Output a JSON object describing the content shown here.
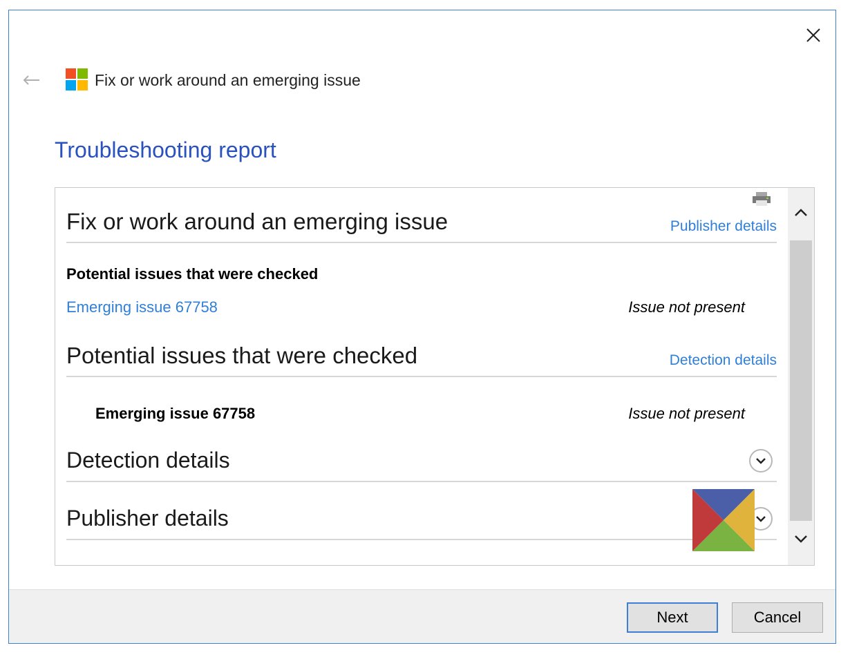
{
  "window": {
    "title": "Fix or work around an emerging issue",
    "icons": {
      "close": "close-icon",
      "back": "back-arrow-icon",
      "app": "windows-logo-icon"
    }
  },
  "heading": "Troubleshooting report",
  "report": {
    "section1": {
      "title": "Fix or work around an emerging issue",
      "link": "Publisher details",
      "subheading": "Potential issues that were checked",
      "issue_link": "Emerging issue 67758",
      "issue_status": "Issue not present"
    },
    "section2": {
      "title": "Potential issues that were checked",
      "link": "Detection details",
      "issue_label": "Emerging issue 67758",
      "issue_status": "Issue not present"
    },
    "section3": {
      "title": "Detection details"
    },
    "section4": {
      "title": "Publisher details"
    }
  },
  "buttons": {
    "next": "Next",
    "cancel": "Cancel"
  },
  "colors": {
    "accent": "#2a52be",
    "link": "#2f7fd8",
    "window_border": "#3e7ed6",
    "footer_bg": "#f0f0f0"
  }
}
